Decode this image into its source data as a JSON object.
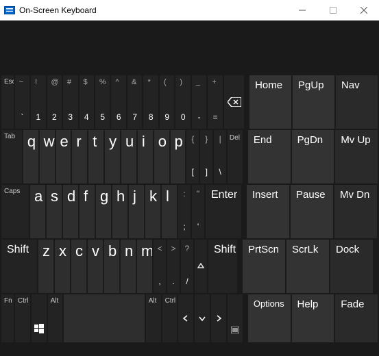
{
  "window": {
    "title": "On-Screen Keyboard"
  },
  "row1": {
    "esc": "Esc",
    "syms_top": [
      "~",
      "!",
      "@",
      "#",
      "$",
      "%",
      "^",
      "&",
      "*",
      "(",
      ")",
      "_",
      "+"
    ],
    "syms_bot": [
      "`",
      "1",
      "2",
      "3",
      "4",
      "5",
      "6",
      "7",
      "8",
      "9",
      "0",
      "-",
      "="
    ]
  },
  "row2": {
    "tab": "Tab",
    "letters": [
      "q",
      "w",
      "e",
      "r",
      "t",
      "y",
      "u",
      "i",
      "o",
      "p"
    ],
    "b1": {
      "t": "{",
      "b": "["
    },
    "b2": {
      "t": "}",
      "b": "]"
    },
    "b3": {
      "t": "|",
      "b": "\\"
    },
    "del": "Del"
  },
  "row3": {
    "caps": "Caps",
    "letters": [
      "a",
      "s",
      "d",
      "f",
      "g",
      "h",
      "j",
      "k",
      "l"
    ],
    "c1": {
      "t": ":",
      "b": ";"
    },
    "c2": {
      "t": "\"",
      "b": "'"
    },
    "enter": "Enter"
  },
  "row4": {
    "shiftL": "Shift",
    "shiftR": "Shift",
    "letters": [
      "z",
      "x",
      "c",
      "v",
      "b",
      "n",
      "m"
    ],
    "d1": {
      "t": "<",
      "b": ","
    },
    "d2": {
      "t": ">",
      "b": "."
    },
    "d3": {
      "t": "?",
      "b": "/"
    }
  },
  "row5": {
    "fn": "Fn",
    "ctrlL": "Ctrl",
    "altL": "Alt",
    "altR": "Alt",
    "ctrlR": "Ctrl"
  },
  "nav": {
    "r1": [
      "Home",
      "PgUp",
      "Nav"
    ],
    "r2": [
      "End",
      "PgDn",
      "Mv Up"
    ],
    "r3": [
      "Insert",
      "Pause",
      "Mv Dn"
    ],
    "r4": [
      "PrtScn",
      "ScrLk",
      "Dock"
    ],
    "r5": [
      "Options",
      "Help",
      "Fade"
    ]
  }
}
